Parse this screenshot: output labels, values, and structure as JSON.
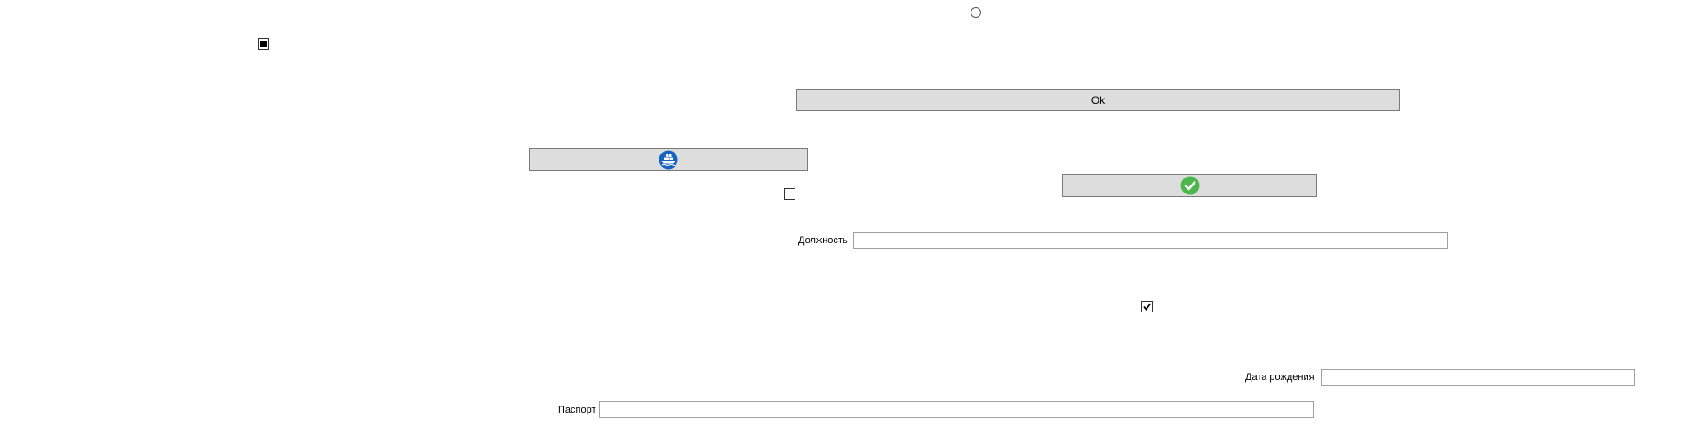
{
  "radio": {
    "checked": false
  },
  "checkbox_top_left": {
    "state": "indeterminate"
  },
  "checkbox_middle": {
    "checked": false
  },
  "checkbox_right": {
    "checked": true
  },
  "ok_button": {
    "label": "Ok"
  },
  "ship_button": {
    "icon": "ship-icon",
    "icon_color": "#1565c0"
  },
  "confirm_button": {
    "icon": "checkmark-circle-icon",
    "icon_color": "#4cb84c"
  },
  "position_field": {
    "label": "Должность",
    "value": ""
  },
  "birthdate_field": {
    "label": "Дата рождения",
    "value": ""
  },
  "passport_field": {
    "label": "Паспорт",
    "value": ""
  }
}
